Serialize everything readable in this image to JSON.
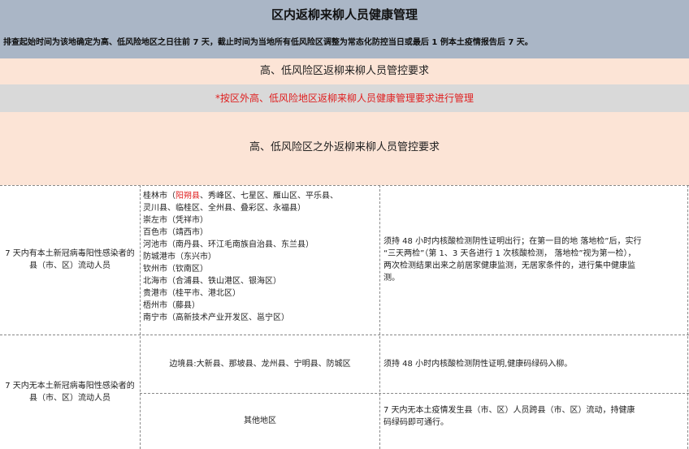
{
  "header": {
    "title": "区内返柳来柳人员健康管理",
    "subtitle": "排查起始时间为该地确定为高、低风险地区之日往前 7 天，截止时间为当地所有低风险区调整为常态化防控当日或最后 1 例本土疫情报告后 7 天。"
  },
  "sections": {
    "high_low_title": "高、低风险区返柳来柳人员管控要求",
    "high_low_note": "*按区外高、低风险地区返柳来柳人员健康管理要求进行管理",
    "outside_title": "高、低风险区之外返柳来柳人员管控要求"
  },
  "table": {
    "row1": {
      "group": "7 天内有本土新冠病毒阳性感染者的县（市、区）流动人员",
      "areas": [
        {
          "pre": "桂林市（",
          "highlight": "阳朔县",
          "post": "、秀峰区、七星区、雁山区、平乐县、"
        },
        {
          "text": "灵川县、临桂区、全州县、叠彩区、永福县）"
        },
        {
          "text": "崇左市（凭祥市）"
        },
        {
          "text": "百色市（靖西市）"
        },
        {
          "text": "河池市（南丹县、环江毛南族自治县、东兰县）"
        },
        {
          "text": "防城港市（东兴市）"
        },
        {
          "text": "钦州市（钦南区）"
        },
        {
          "text": "北海市（合浦县、铁山港区、银海区）"
        },
        {
          "text": "贵港市（桂平市、港北区）"
        },
        {
          "text": "梧州市（藤县）"
        },
        {
          "text": "南宁市（高新技术产业开发区、邕宁区）"
        }
      ],
      "requirement_lines": [
        "须持 48 小时内核酸检测阴性证明出行；在第一目的地 落地检”后，实行",
        "“三天两检”（第 1、3 天各进行 1 次核酸检测， 落地检”视为第一检），",
        "两次检测结果出来之前居家健康监测，无居家条件的，进行集中健康监",
        "测。"
      ]
    },
    "row2": {
      "group": "7 天内无本土新冠病毒阳性感染者的县（市、区）流动人员",
      "border_areas": "边境县:大新县、那坡县、龙州县、宁明县、防城区",
      "border_requirement": "须持 48 小时内核酸检测阴性证明,健康码绿码入柳。",
      "other_areas": "其他地区",
      "other_requirement_lines": [
        "7 天内无本土疫情发生县（市、区）人员跨县（市、区）流动，持健康",
        "码绿码即可通行。"
      ]
    }
  },
  "colors": {
    "header_bg": "#aab6c6",
    "band_peach": "#fce4d6",
    "band_gray": "#d9d9d9",
    "accent_red": "#e02020"
  }
}
